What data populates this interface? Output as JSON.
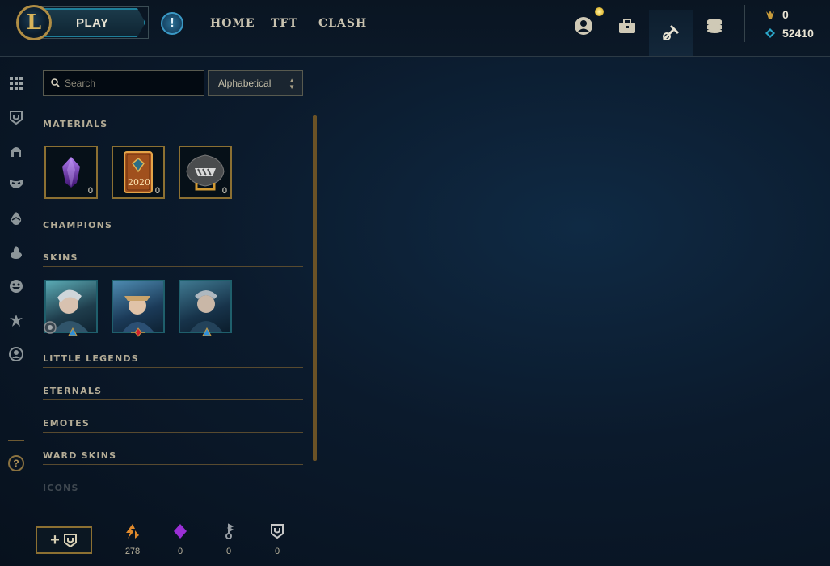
{
  "header": {
    "logo_letter": "L",
    "play_label": "PLAY",
    "alert_glyph": "!",
    "nav": [
      "HOME",
      "TFT",
      "CLASH"
    ],
    "icons": [
      "profile-icon",
      "collection-icon",
      "loot-icon",
      "store-icon"
    ],
    "currency": {
      "blue_essence": "0",
      "riot_points": "52410"
    }
  },
  "sidebar": {
    "icons": [
      "grid-icon",
      "ward-icon",
      "helmet-icon",
      "mask-icon",
      "egg-icon",
      "flame-icon",
      "emote-icon",
      "eternal-icon",
      "profile-icon"
    ],
    "help_glyph": "?"
  },
  "controls": {
    "search_placeholder": "Search",
    "sort_value": "Alphabetical"
  },
  "sections": {
    "materials": "MATERIALS",
    "champions": "CHAMPIONS",
    "skins": "SKINS",
    "little_legends": "LITTLE LEGENDS",
    "eternals": "ETERNALS",
    "emotes": "EMOTES",
    "ward_skins": "WARD SKINS",
    "icons": "ICONS"
  },
  "materials": [
    {
      "name": "mystery-crystal",
      "count": "0"
    },
    {
      "name": "event-pass-2020",
      "label": "2020",
      "count": "0"
    },
    {
      "name": "hextech-chest",
      "count": "0"
    }
  ],
  "skins": [
    {
      "name": "skin-1",
      "rarity": "blue"
    },
    {
      "name": "skin-2",
      "rarity": "red"
    },
    {
      "name": "skin-3",
      "rarity": "blue"
    }
  ],
  "footer": {
    "add_label": "+",
    "stats": [
      {
        "icon": "orange-essence-icon",
        "value": "278"
      },
      {
        "icon": "gem-icon",
        "value": "0"
      },
      {
        "icon": "key-fragment-icon",
        "value": "0"
      },
      {
        "icon": "ward-token-icon",
        "value": "0"
      }
    ],
    "colors": {
      "orange": "#e08a2c",
      "gem": "#9b2fd6",
      "key": "#9aa0a6",
      "ward": "#c7c7c7"
    }
  }
}
